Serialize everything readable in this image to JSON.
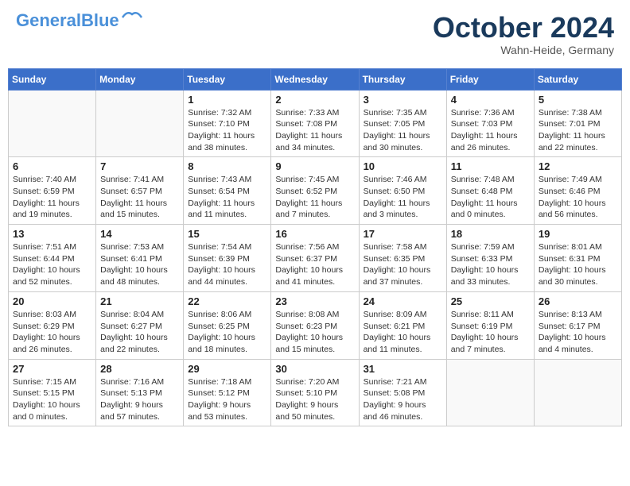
{
  "header": {
    "logo_line1": "General",
    "logo_line2": "Blue",
    "month": "October 2024",
    "location": "Wahn-Heide, Germany"
  },
  "days_of_week": [
    "Sunday",
    "Monday",
    "Tuesday",
    "Wednesday",
    "Thursday",
    "Friday",
    "Saturday"
  ],
  "weeks": [
    [
      {
        "num": "",
        "info": ""
      },
      {
        "num": "",
        "info": ""
      },
      {
        "num": "1",
        "info": "Sunrise: 7:32 AM\nSunset: 7:10 PM\nDaylight: 11 hours and 38 minutes."
      },
      {
        "num": "2",
        "info": "Sunrise: 7:33 AM\nSunset: 7:08 PM\nDaylight: 11 hours and 34 minutes."
      },
      {
        "num": "3",
        "info": "Sunrise: 7:35 AM\nSunset: 7:05 PM\nDaylight: 11 hours and 30 minutes."
      },
      {
        "num": "4",
        "info": "Sunrise: 7:36 AM\nSunset: 7:03 PM\nDaylight: 11 hours and 26 minutes."
      },
      {
        "num": "5",
        "info": "Sunrise: 7:38 AM\nSunset: 7:01 PM\nDaylight: 11 hours and 22 minutes."
      }
    ],
    [
      {
        "num": "6",
        "info": "Sunrise: 7:40 AM\nSunset: 6:59 PM\nDaylight: 11 hours and 19 minutes."
      },
      {
        "num": "7",
        "info": "Sunrise: 7:41 AM\nSunset: 6:57 PM\nDaylight: 11 hours and 15 minutes."
      },
      {
        "num": "8",
        "info": "Sunrise: 7:43 AM\nSunset: 6:54 PM\nDaylight: 11 hours and 11 minutes."
      },
      {
        "num": "9",
        "info": "Sunrise: 7:45 AM\nSunset: 6:52 PM\nDaylight: 11 hours and 7 minutes."
      },
      {
        "num": "10",
        "info": "Sunrise: 7:46 AM\nSunset: 6:50 PM\nDaylight: 11 hours and 3 minutes."
      },
      {
        "num": "11",
        "info": "Sunrise: 7:48 AM\nSunset: 6:48 PM\nDaylight: 11 hours and 0 minutes."
      },
      {
        "num": "12",
        "info": "Sunrise: 7:49 AM\nSunset: 6:46 PM\nDaylight: 10 hours and 56 minutes."
      }
    ],
    [
      {
        "num": "13",
        "info": "Sunrise: 7:51 AM\nSunset: 6:44 PM\nDaylight: 10 hours and 52 minutes."
      },
      {
        "num": "14",
        "info": "Sunrise: 7:53 AM\nSunset: 6:41 PM\nDaylight: 10 hours and 48 minutes."
      },
      {
        "num": "15",
        "info": "Sunrise: 7:54 AM\nSunset: 6:39 PM\nDaylight: 10 hours and 44 minutes."
      },
      {
        "num": "16",
        "info": "Sunrise: 7:56 AM\nSunset: 6:37 PM\nDaylight: 10 hours and 41 minutes."
      },
      {
        "num": "17",
        "info": "Sunrise: 7:58 AM\nSunset: 6:35 PM\nDaylight: 10 hours and 37 minutes."
      },
      {
        "num": "18",
        "info": "Sunrise: 7:59 AM\nSunset: 6:33 PM\nDaylight: 10 hours and 33 minutes."
      },
      {
        "num": "19",
        "info": "Sunrise: 8:01 AM\nSunset: 6:31 PM\nDaylight: 10 hours and 30 minutes."
      }
    ],
    [
      {
        "num": "20",
        "info": "Sunrise: 8:03 AM\nSunset: 6:29 PM\nDaylight: 10 hours and 26 minutes."
      },
      {
        "num": "21",
        "info": "Sunrise: 8:04 AM\nSunset: 6:27 PM\nDaylight: 10 hours and 22 minutes."
      },
      {
        "num": "22",
        "info": "Sunrise: 8:06 AM\nSunset: 6:25 PM\nDaylight: 10 hours and 18 minutes."
      },
      {
        "num": "23",
        "info": "Sunrise: 8:08 AM\nSunset: 6:23 PM\nDaylight: 10 hours and 15 minutes."
      },
      {
        "num": "24",
        "info": "Sunrise: 8:09 AM\nSunset: 6:21 PM\nDaylight: 10 hours and 11 minutes."
      },
      {
        "num": "25",
        "info": "Sunrise: 8:11 AM\nSunset: 6:19 PM\nDaylight: 10 hours and 7 minutes."
      },
      {
        "num": "26",
        "info": "Sunrise: 8:13 AM\nSunset: 6:17 PM\nDaylight: 10 hours and 4 minutes."
      }
    ],
    [
      {
        "num": "27",
        "info": "Sunrise: 7:15 AM\nSunset: 5:15 PM\nDaylight: 10 hours and 0 minutes."
      },
      {
        "num": "28",
        "info": "Sunrise: 7:16 AM\nSunset: 5:13 PM\nDaylight: 9 hours and 57 minutes."
      },
      {
        "num": "29",
        "info": "Sunrise: 7:18 AM\nSunset: 5:12 PM\nDaylight: 9 hours and 53 minutes."
      },
      {
        "num": "30",
        "info": "Sunrise: 7:20 AM\nSunset: 5:10 PM\nDaylight: 9 hours and 50 minutes."
      },
      {
        "num": "31",
        "info": "Sunrise: 7:21 AM\nSunset: 5:08 PM\nDaylight: 9 hours and 46 minutes."
      },
      {
        "num": "",
        "info": ""
      },
      {
        "num": "",
        "info": ""
      }
    ]
  ]
}
